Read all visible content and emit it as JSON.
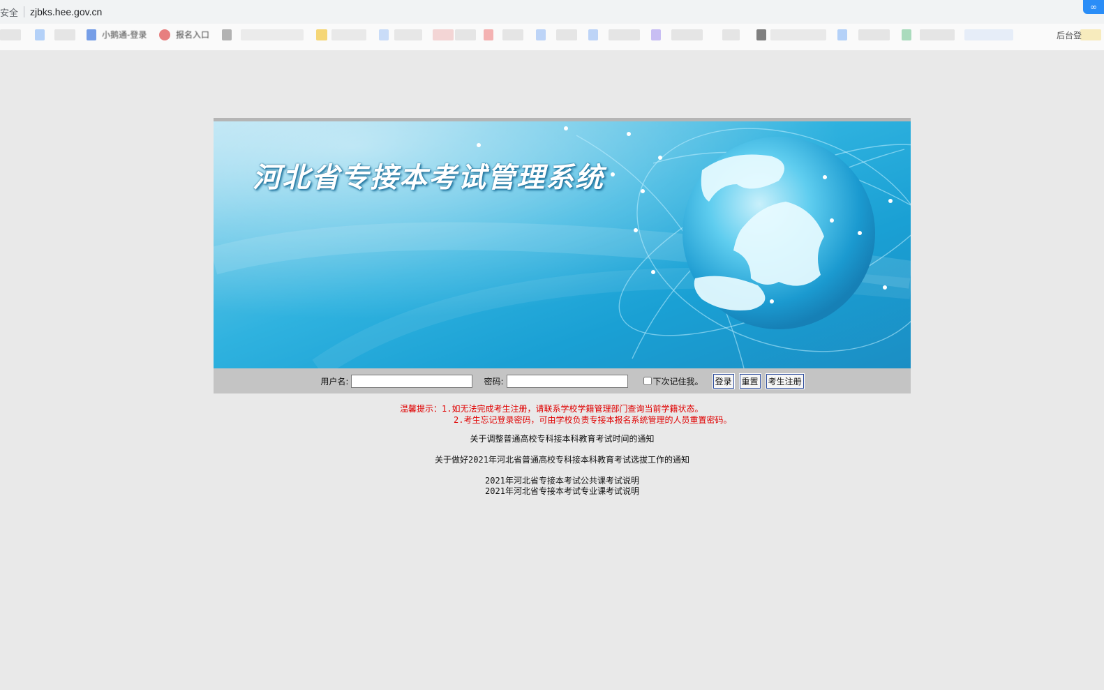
{
  "browser": {
    "security_label": "安全",
    "url": "zjbks.hee.gov.cn",
    "bookmarks": [
      "小鹅通-登录",
      "报名入口"
    ],
    "bookmark_right": "后台登",
    "extension_icon": "link-icon"
  },
  "banner": {
    "title": "河北省专接本考试管理系统",
    "graphic": "globe-europe"
  },
  "login": {
    "username_label": "用户名:",
    "password_label": "密码:",
    "remember_label": "下次记住我。",
    "login_button": "登录",
    "reset_button": "重置",
    "register_button": "考生注册",
    "username_value": "",
    "password_value": ""
  },
  "hint": {
    "line1": "温馨提示：1.如无法完成考生注册，请联系学校学籍管理部门查询当前学籍状态。",
    "line2": "2.考生忘记登录密码，可由学校负责专接本报名系统管理的人员重置密码。"
  },
  "notices": {
    "n1": "关于调整普通高校专科接本科教育考试时间的通知",
    "n2": "关于做好2021年河北省普通高校专科接本科教育考试选拔工作的通知",
    "n3": "2021年河北省专接本考试公共课考试说明",
    "n4": "2021年河北省专接本考试专业课考试说明"
  },
  "colors": {
    "hint": "#e00000",
    "background": "#e9e9e9",
    "login_bar": "#c4c4c4",
    "banner_blue": "#1aa0d4"
  }
}
